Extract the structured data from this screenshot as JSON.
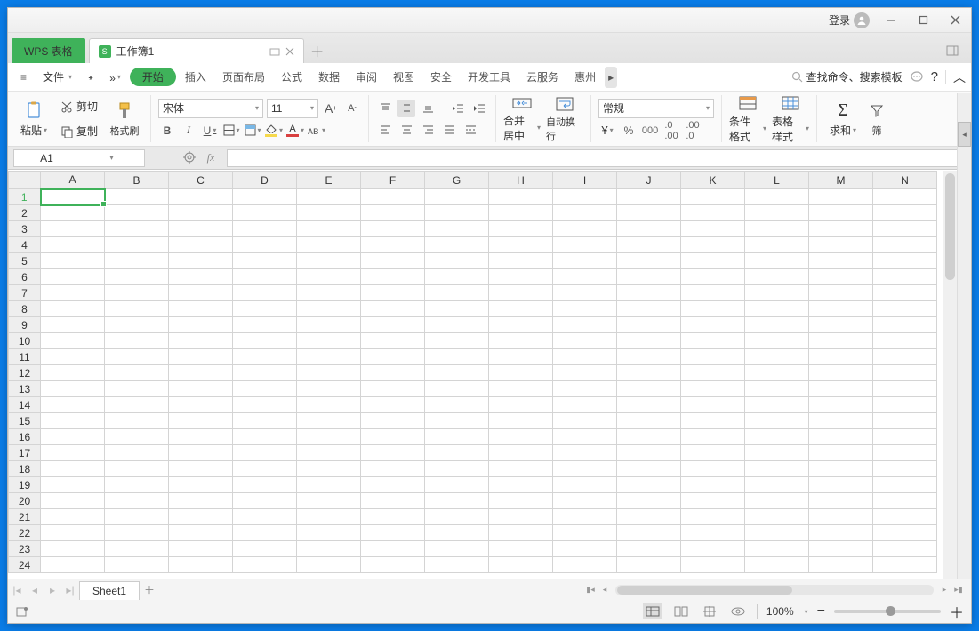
{
  "titlebar": {
    "login": "登录"
  },
  "apptab": {
    "label": "WPS 表格"
  },
  "filetab": {
    "name": "工作簿1"
  },
  "menu": {
    "file": "文件",
    "start": "开始",
    "insert": "插入",
    "layout": "页面布局",
    "formula": "公式",
    "data": "数据",
    "review": "审阅",
    "view": "视图",
    "security": "安全",
    "devtools": "开发工具",
    "cloud": "云服务",
    "huizhou": "惠州",
    "search_placeholder": "查找命令、搜索模板"
  },
  "ribbon": {
    "paste": "粘贴",
    "cut": "剪切",
    "copy": "复制",
    "brush": "格式刷",
    "font": "宋体",
    "size": "11",
    "merge": "合并居中",
    "wrap": "自动换行",
    "numfmt": "常规",
    "cond": "条件格式",
    "tablestyle": "表格样式",
    "sum": "求和",
    "filter": "筛"
  },
  "namebox": {
    "ref": "A1"
  },
  "columns": [
    "A",
    "B",
    "C",
    "D",
    "E",
    "F",
    "G",
    "H",
    "I",
    "J",
    "K",
    "L",
    "M",
    "N"
  ],
  "rows": [
    1,
    2,
    3,
    4,
    5,
    6,
    7,
    8,
    9,
    10,
    11,
    12,
    13,
    14,
    15,
    16,
    17,
    18,
    19,
    20,
    21,
    22,
    23,
    24
  ],
  "sheet": {
    "name": "Sheet1"
  },
  "status": {
    "zoom": "100%"
  },
  "selection": {
    "col": "A",
    "row": 1
  }
}
